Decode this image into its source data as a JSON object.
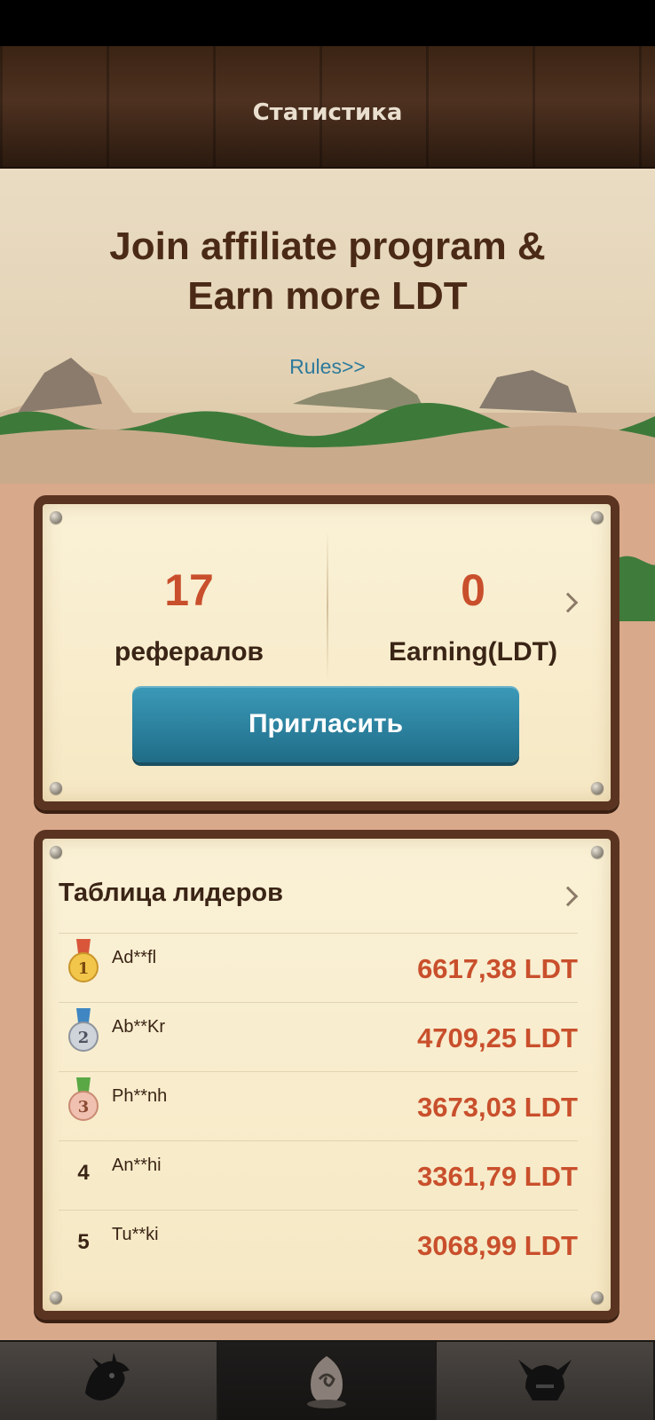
{
  "header": {
    "title": "Статистика"
  },
  "hero": {
    "title_line1": "Join affiliate program &",
    "title_line2": "Earn more LDT",
    "rules_link": "Rules>>"
  },
  "stats": {
    "referrals_value": "17",
    "referrals_label": "рефералов",
    "earning_value": "0",
    "earning_label": "Earning(LDT)",
    "invite_button": "Пригласить"
  },
  "leaderboard": {
    "title": "Таблица лидеров",
    "rows": [
      {
        "rank": "1",
        "name": "Ad**fl",
        "amount": "6617,38 LDT",
        "medal": "gold-medal-icon"
      },
      {
        "rank": "2",
        "name": "Ab**Kr",
        "amount": "4709,25 LDT",
        "medal": "silver-medal-icon"
      },
      {
        "rank": "3",
        "name": "Ph**nh",
        "amount": "3673,03 LDT",
        "medal": "bronze-medal-icon"
      },
      {
        "rank": "4",
        "name": "An**hi",
        "amount": "3361,79 LDT",
        "medal": ""
      },
      {
        "rank": "5",
        "name": "Tu**ki",
        "amount": "3068,99 LDT",
        "medal": ""
      }
    ]
  },
  "tabbar": {
    "tabs": [
      {
        "icon": "dragon-icon",
        "active": false
      },
      {
        "icon": "egg-icon",
        "active": true
      },
      {
        "icon": "helmet-icon",
        "active": false
      }
    ]
  },
  "colors": {
    "accent_value": "#c94f2c",
    "button": "#2a7f9c",
    "frame": "#5a3421",
    "parchment": "#f6e8c4"
  }
}
